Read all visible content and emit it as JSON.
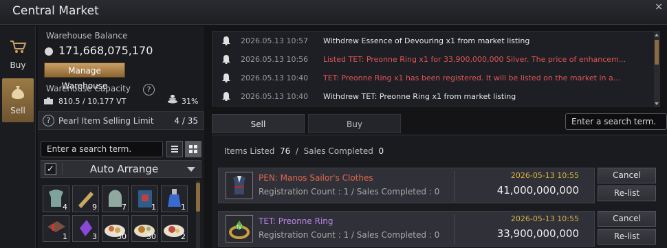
{
  "window": {
    "title": "Central Market",
    "close_glyph": "×"
  },
  "side_tabs": [
    {
      "label": "Buy",
      "icon": "cart-icon"
    },
    {
      "label": "Sell",
      "icon": "money-bag-icon"
    }
  ],
  "warehouse": {
    "balance_label": "Warehouse Balance",
    "balance_value": "171,668,075,170",
    "manage_label": "Manage Warehouse",
    "capacity_label": "Warehouse Capacity",
    "capacity_value": "810.5 / 10,177 VT",
    "capacity_percent": "31%"
  },
  "pearl": {
    "label": "Pearl Item Selling Limit",
    "count": "4 / 35"
  },
  "inventory": {
    "search_placeholder": "Enter a search term.",
    "auto_arrange_label": "Auto Arrange",
    "auto_arrange_checked": true,
    "check_glyph": "✓",
    "slot_counts": [
      "4",
      "9",
      "7",
      "1",
      "1",
      "1",
      "3",
      "30",
      "30",
      "2"
    ]
  },
  "log": [
    {
      "time": "2026.05.13 10:57",
      "message": "Withdrew Essence of Devouring x1 from market listing",
      "color": "#e6e6e6"
    },
    {
      "time": "2026.05.13 10:56",
      "message": "Listed TET: Preonne Ring x1 for 33,900,000,000 Silver. The price of enhancem...",
      "color": "#e05555"
    },
    {
      "time": "2026.05.13 10:40",
      "message": "TET: Preonne Ring x1 has been registered. It will be listed on the market in a...",
      "color": "#e05555"
    },
    {
      "time": "2026.05.13 10:40",
      "message": "Withdrew TET: Preonne Ring x1 from market listing",
      "color": "#e6e6e6"
    }
  ],
  "tabs": {
    "sell": "Sell",
    "buy": "Buy"
  },
  "main_search_placeholder": "Enter a search term.",
  "summary": {
    "listed_label": "Items Listed",
    "listed_value": "76",
    "separator": "/",
    "completed_label": "Sales Completed",
    "completed_value": "0"
  },
  "listings": [
    {
      "name": "PEN: Manos Sailor's Clothes",
      "name_color": "#e0674c",
      "meta": "Registration Count : 1 / Sales Completed : 0",
      "date": "2026-05-13 10:55",
      "price": "41,000,000,000",
      "cancel_label": "Cancel",
      "relist_label": "Re-list"
    },
    {
      "name": "TET: Preonne Ring",
      "name_color": "#b985e8",
      "meta": "Registration Count : 1 / Sales Completed : 0",
      "date": "2026-05-13 10:55",
      "price": "33,900,000,000",
      "cancel_label": "Cancel",
      "relist_label": "Re-list"
    }
  ]
}
